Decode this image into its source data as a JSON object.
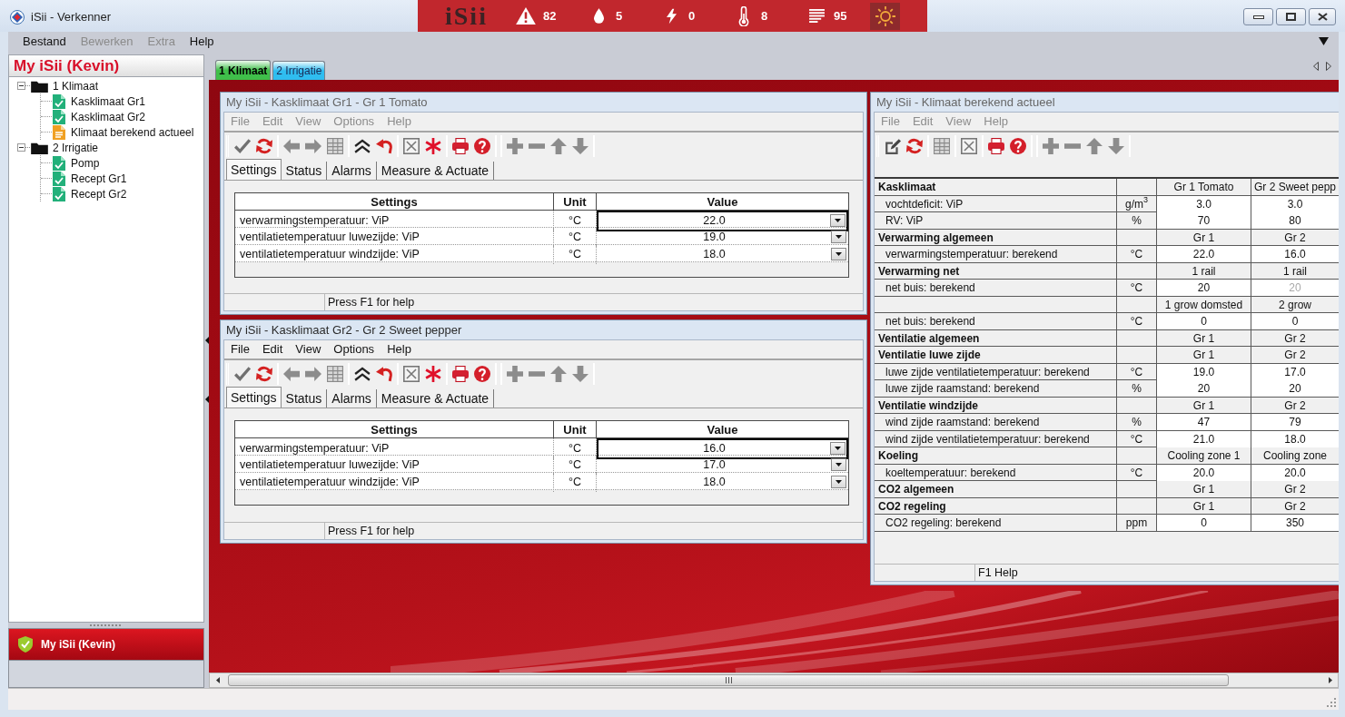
{
  "window": {
    "title": "iSii - Verkenner"
  },
  "status_strip": {
    "logo": "iSii",
    "counters": [
      {
        "kind": "alarm",
        "count": "82"
      },
      {
        "kind": "water",
        "count": "5"
      },
      {
        "kind": "power",
        "count": "0"
      },
      {
        "kind": "temperature",
        "count": "8"
      },
      {
        "kind": "messages",
        "count": "95"
      }
    ],
    "weather_button": {
      "selected": true
    }
  },
  "menu": [
    {
      "label": "Bestand",
      "disabled": false
    },
    {
      "label": "Bewerken",
      "disabled": true
    },
    {
      "label": "Extra",
      "disabled": true
    },
    {
      "label": "Help",
      "disabled": false
    }
  ],
  "sidebar": {
    "title": "My iSii (Kevin)",
    "tree": [
      {
        "label": "1 Klimaat",
        "kind": "folder",
        "expanded": true,
        "children": [
          {
            "label": "Kasklimaat Gr1",
            "kind": "form"
          },
          {
            "label": "Kasklimaat Gr2",
            "kind": "form"
          },
          {
            "label": "Klimaat berekend actueel",
            "kind": "report"
          }
        ]
      },
      {
        "label": "2 Irrigatie",
        "kind": "folder",
        "expanded": true,
        "children": [
          {
            "label": "Pomp",
            "kind": "form"
          },
          {
            "label": "Recept Gr1",
            "kind": "form"
          },
          {
            "label": "Recept Gr2",
            "kind": "form"
          }
        ]
      }
    ],
    "nav_buttons": [
      {
        "label": "My iSii (Kevin)",
        "selected": true
      }
    ]
  },
  "tabs": [
    {
      "label": "1 Klimaat",
      "selected": true,
      "color": "#3fbf4a"
    },
    {
      "label": "2 Irrigatie",
      "selected": false,
      "color": "#2fbdf0"
    }
  ],
  "windows": [
    {
      "kind": "settings",
      "title": "My iSii - Kasklimaat Gr1 - Gr 1 Tomato",
      "active": false,
      "menu": [
        "File",
        "Edit",
        "View",
        "Options",
        "Help"
      ],
      "tabs": [
        {
          "label": "Settings",
          "selected": true
        },
        {
          "label": "Status",
          "selected": false
        },
        {
          "label": "Alarms",
          "selected": false
        },
        {
          "label": "Measure & Actuate",
          "selected": false
        }
      ],
      "table": {
        "columns": [
          "Settings",
          "Unit",
          "Value"
        ],
        "rows": [
          {
            "label": "verwarmingstemperatuur: ViP",
            "unit": "°C",
            "value": "22.0",
            "selected": true
          },
          {
            "label": "ventilatietemperatuur luwezijde: ViP",
            "unit": "°C",
            "value": "19.0",
            "selected": false
          },
          {
            "label": "ventilatietemperatuur windzijde: ViP",
            "unit": "°C",
            "value": "18.0",
            "selected": false
          }
        ]
      },
      "status": "Press F1 for help"
    },
    {
      "kind": "settings",
      "title": "My iSii - Kasklimaat Gr2 - Gr 2 Sweet pepper",
      "active": true,
      "menu": [
        "File",
        "Edit",
        "View",
        "Options",
        "Help"
      ],
      "tabs": [
        {
          "label": "Settings",
          "selected": true
        },
        {
          "label": "Status",
          "selected": false
        },
        {
          "label": "Alarms",
          "selected": false
        },
        {
          "label": "Measure & Actuate",
          "selected": false
        }
      ],
      "table": {
        "columns": [
          "Settings",
          "Unit",
          "Value"
        ],
        "rows": [
          {
            "label": "verwarmingstemperatuur: ViP",
            "unit": "°C",
            "value": "16.0",
            "selected": true
          },
          {
            "label": "ventilatietemperatuur luwezijde: ViP",
            "unit": "°C",
            "value": "17.0",
            "selected": false
          },
          {
            "label": "ventilatietemperatuur windzijde: ViP",
            "unit": "°C",
            "value": "18.0",
            "selected": false
          }
        ]
      },
      "status": "Press F1 for help"
    },
    {
      "kind": "report",
      "title": "My iSii - Klimaat berekend actueel",
      "active": false,
      "menu": [
        "File",
        "Edit",
        "View",
        "Help"
      ],
      "table": {
        "rows": [
          {
            "kind": "group",
            "label": "Kasklimaat",
            "values": [
              {
                "text": "Gr 1 Tomato",
                "greyed": false
              },
              {
                "text": "Gr 2 Sweet pepp",
                "greyed": false
              }
            ]
          },
          {
            "kind": "item",
            "label": "vochtdeficit: ViP",
            "unit": "g/m$^{3}$",
            "values": [
              {
                "text": "3.0",
                "greyed": false
              },
              {
                "text": "3.0",
                "greyed": false
              }
            ]
          },
          {
            "kind": "item",
            "label": "RV: ViP",
            "unit": "%",
            "values": [
              {
                "text": "70",
                "greyed": false
              },
              {
                "text": "80",
                "greyed": false
              }
            ]
          },
          {
            "kind": "group",
            "label": "Verwarming algemeen",
            "values": [
              {
                "text": "Gr 1",
                "greyed": false
              },
              {
                "text": "Gr 2",
                "greyed": false
              }
            ]
          },
          {
            "kind": "item",
            "label": "verwarmingstemperatuur: berekend",
            "unit": "°C",
            "values": [
              {
                "text": "22.0",
                "greyed": false
              },
              {
                "text": "16.0",
                "greyed": false
              }
            ]
          },
          {
            "kind": "group",
            "label": "Verwarming net",
            "values": [
              {
                "text": "1 rail",
                "greyed": false
              },
              {
                "text": "1 rail",
                "greyed": false
              }
            ]
          },
          {
            "kind": "item",
            "label": "net buis: berekend",
            "unit": "°C",
            "values": [
              {
                "text": "20",
                "greyed": false
              },
              {
                "text": "20",
                "greyed": true
              }
            ]
          },
          {
            "kind": "group",
            "values": [
              {
                "text": "1 grow domsted",
                "greyed": false
              },
              {
                "text": "2 grow",
                "greyed": false
              }
            ]
          },
          {
            "kind": "item",
            "label": "net buis: berekend",
            "unit": "°C",
            "values": [
              {
                "text": "0",
                "greyed": false
              },
              {
                "text": "0",
                "greyed": false
              }
            ]
          },
          {
            "kind": "group",
            "label": "Ventilatie algemeen",
            "values": [
              {
                "text": "Gr 1",
                "greyed": false
              },
              {
                "text": "Gr 2",
                "greyed": false
              }
            ]
          },
          {
            "kind": "group",
            "label": "Ventilatie luwe zijde",
            "values": [
              {
                "text": "Gr 1",
                "greyed": false
              },
              {
                "text": "Gr 2",
                "greyed": false
              }
            ]
          },
          {
            "kind": "item",
            "label": "luwe zijde ventilatietemperatuur: berekend",
            "unit": "°C",
            "values": [
              {
                "text": "19.0",
                "greyed": false
              },
              {
                "text": "17.0",
                "greyed": false
              }
            ]
          },
          {
            "kind": "item",
            "label": "luwe zijde raamstand: berekend",
            "unit": "%",
            "values": [
              {
                "text": "20",
                "greyed": false
              },
              {
                "text": "20",
                "greyed": false
              }
            ]
          },
          {
            "kind": "group",
            "label": "Ventilatie windzijde",
            "values": [
              {
                "text": "Gr 1",
                "greyed": false
              },
              {
                "text": "Gr 2",
                "greyed": false
              }
            ]
          },
          {
            "kind": "item",
            "label": "wind zijde raamstand: berekend",
            "unit": "%",
            "values": [
              {
                "text": "47",
                "greyed": false
              },
              {
                "text": "79",
                "greyed": false
              }
            ]
          },
          {
            "kind": "item",
            "label": "wind zijde ventilatietemperatuur: berekend",
            "unit": "°C",
            "values": [
              {
                "text": "21.0",
                "greyed": false
              },
              {
                "text": "18.0",
                "greyed": false
              }
            ]
          },
          {
            "kind": "group",
            "label": "Koeling",
            "values": [
              {
                "text": "Cooling zone 1",
                "greyed": false
              },
              {
                "text": "Cooling zone",
                "greyed": false
              }
            ]
          },
          {
            "kind": "item",
            "label": "koeltemperatuur: berekend",
            "unit": "°C",
            "values": [
              {
                "text": "20.0",
                "greyed": false
              },
              {
                "text": "20.0",
                "greyed": false
              }
            ]
          },
          {
            "kind": "group",
            "label": "CO2 algemeen",
            "values": [
              {
                "text": "Gr 1",
                "greyed": false
              },
              {
                "text": "Gr 2",
                "greyed": false
              }
            ]
          },
          {
            "kind": "group",
            "label": "CO2 regeling",
            "values": [
              {
                "text": "Gr 1",
                "greyed": false
              },
              {
                "text": "Gr 2",
                "greyed": false
              }
            ]
          },
          {
            "kind": "item",
            "label": "CO2 regeling: berekend",
            "unit": "ppm",
            "values": [
              {
                "text": "0",
                "greyed": false
              },
              {
                "text": "350",
                "greyed": false
              }
            ]
          }
        ]
      },
      "status": "F1 Help"
    }
  ]
}
